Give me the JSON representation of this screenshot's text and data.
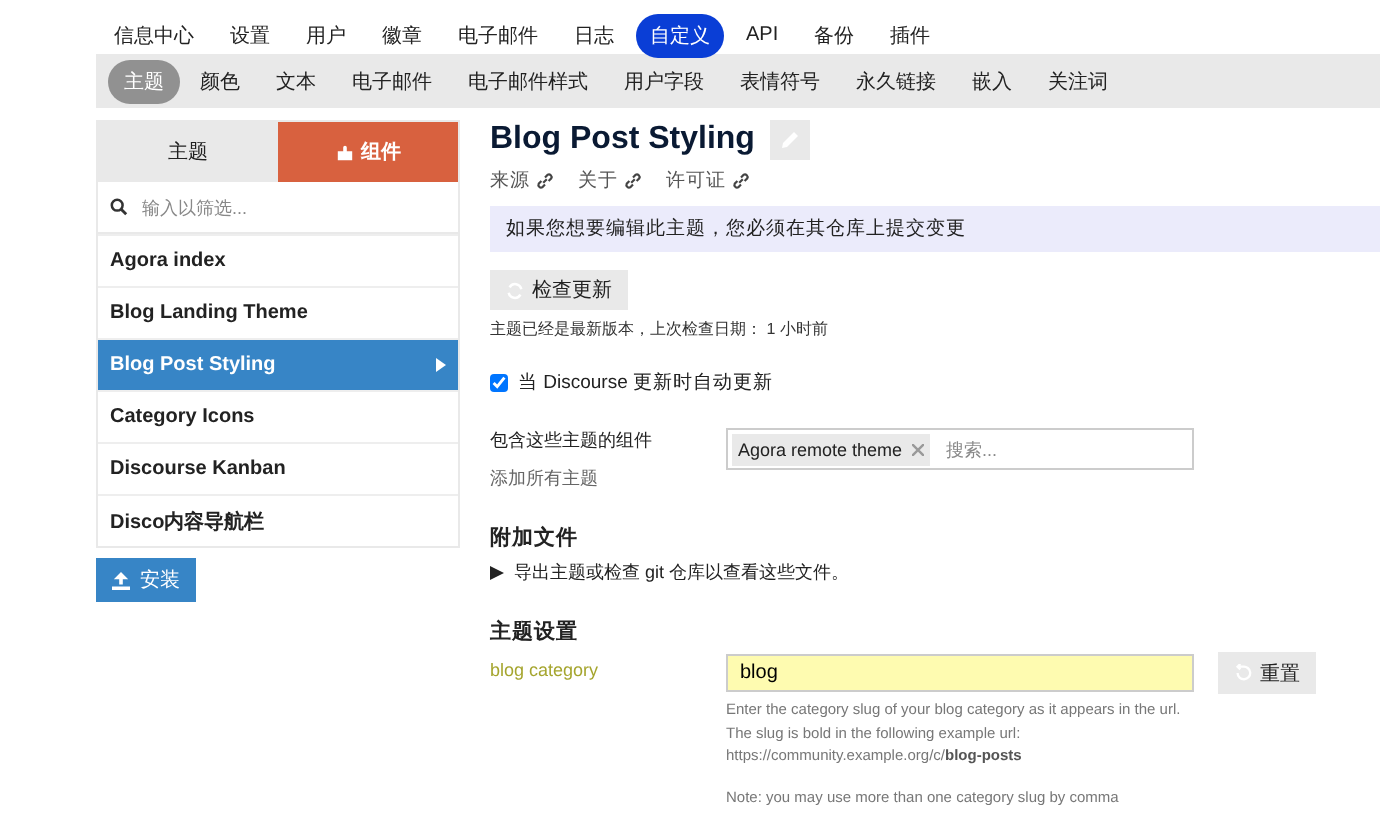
{
  "nav": [
    {
      "label": "信息中心",
      "selected": false
    },
    {
      "label": "设置",
      "selected": false
    },
    {
      "label": "用户",
      "selected": false
    },
    {
      "label": "徽章",
      "selected": false
    },
    {
      "label": "电子邮件",
      "selected": false
    },
    {
      "label": "日志",
      "selected": false
    },
    {
      "label": "自定义",
      "selected": true
    },
    {
      "label": "API",
      "selected": false
    },
    {
      "label": "备份",
      "selected": false
    },
    {
      "label": "插件",
      "selected": false
    }
  ],
  "subnav": [
    {
      "label": "主题",
      "selected": true
    },
    {
      "label": "颜色",
      "selected": false
    },
    {
      "label": "文本",
      "selected": false
    },
    {
      "label": "电子邮件",
      "selected": false
    },
    {
      "label": "电子邮件样式",
      "selected": false
    },
    {
      "label": "用户字段",
      "selected": false
    },
    {
      "label": "表情符号",
      "selected": false
    },
    {
      "label": "永久链接",
      "selected": false
    },
    {
      "label": "嵌入",
      "selected": false
    },
    {
      "label": "关注词",
      "selected": false
    }
  ],
  "sidebar": {
    "tabs": [
      {
        "label": "主题",
        "selected": false
      },
      {
        "label": "组件",
        "selected": true
      }
    ],
    "filter": {
      "placeholder": "输入以筛选..."
    },
    "items": [
      {
        "label": "Agora index",
        "selected": false
      },
      {
        "label": "Blog Landing Theme",
        "selected": false
      },
      {
        "label": "Blog Post Styling",
        "selected": true
      },
      {
        "label": "Category Icons",
        "selected": false
      },
      {
        "label": "Discourse Kanban",
        "selected": false
      },
      {
        "label": "Disco内容导航栏",
        "selected": false
      }
    ],
    "install_button": "安装"
  },
  "detail": {
    "title": "Blog Post Styling",
    "links": [
      "来源",
      "关于",
      "许可证"
    ],
    "notice": "如果您想要编辑此主题，您必须在其仓库上提交变更",
    "check_button": "检查更新",
    "status": "主题已经是最新版本，上次检查日期： 1 小时前",
    "auto_update": {
      "label": "当 Discourse 更新时自动更新",
      "checked": true
    },
    "parents": {
      "label": "包含这些主题的组件",
      "add_all": "添加所有主题",
      "chips": [
        "Agora remote theme"
      ],
      "placeholder": "搜索..."
    },
    "files": {
      "heading": "附加文件",
      "text": "导出主题或检查 git 仓库以查看这些文件。"
    },
    "settings": {
      "heading": "主题设置",
      "name": "blog category",
      "value": "blog",
      "reset": "重置",
      "description": [
        {
          "lines": [
            "Enter the category slug of your blog category as it appears in the url.",
            "The slug is bold in the following example url:",
            "https://community.example.org/c/**blog-posts**"
          ]
        },
        {
          "lines": [
            "Note: you may use more than one category slug by comma"
          ]
        }
      ]
    }
  }
}
